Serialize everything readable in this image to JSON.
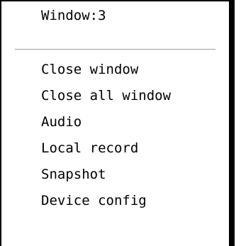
{
  "menu": {
    "header": "Window:3",
    "items": [
      {
        "label": "Close window"
      },
      {
        "label": "Close all window"
      },
      {
        "label": "Audio"
      },
      {
        "label": "Local record"
      },
      {
        "label": "Snapshot"
      },
      {
        "label": "Device config"
      }
    ]
  },
  "colors": {
    "border": "#000000",
    "separator": "#a0a0a0",
    "background": "#ffffff",
    "text": "#000000"
  }
}
